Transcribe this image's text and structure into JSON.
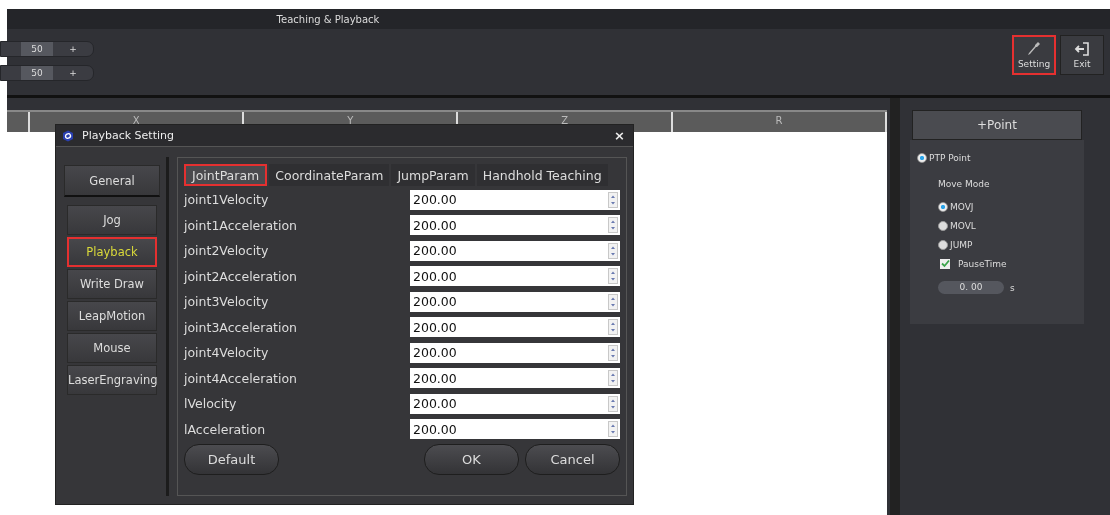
{
  "window": {
    "title": "Teaching & Playback"
  },
  "steppers": [
    {
      "value": "50",
      "plus": "+"
    },
    {
      "value": "50",
      "plus": "+"
    }
  ],
  "toolbar": [
    {
      "kind": "setting",
      "label": "Setting",
      "highlighted": true
    },
    {
      "kind": "exit",
      "label": "Exit",
      "highlighted": false
    }
  ],
  "table": {
    "columns": [
      "X",
      "Y",
      "Z",
      "R"
    ]
  },
  "right_panel": {
    "add_button": "+Point",
    "ptp": {
      "label": "PTP Point",
      "selected": true
    },
    "move_mode_label": "Move Mode",
    "modes": [
      {
        "label": "MOVJ",
        "selected": true
      },
      {
        "label": "MOVL",
        "selected": false
      },
      {
        "label": "JUMP",
        "selected": false
      }
    ],
    "pause": {
      "label": "PauseTime",
      "checked": true
    },
    "pause_value": "0. 00",
    "unit": "s"
  },
  "dialog": {
    "title": "Playback Setting",
    "close": "×",
    "nav": [
      {
        "label": "General",
        "selected": false,
        "highlighted": false
      },
      {
        "label": "Jog",
        "selected": false,
        "highlighted": false
      },
      {
        "label": "Playback",
        "selected": true,
        "highlighted": true
      },
      {
        "label": "Write  Draw",
        "selected": false,
        "highlighted": false
      },
      {
        "label": "LeapMotion",
        "selected": false,
        "highlighted": false
      },
      {
        "label": "Mouse",
        "selected": false,
        "highlighted": false
      },
      {
        "label": "LaserEngraving",
        "selected": false,
        "highlighted": false
      }
    ],
    "tabs": [
      {
        "label": "JointParam",
        "selected": true,
        "highlighted": true
      },
      {
        "label": "CoordinateParam",
        "selected": false,
        "highlighted": false
      },
      {
        "label": "JumpParam",
        "selected": false,
        "highlighted": false
      },
      {
        "label": "Handhold Teaching",
        "selected": false,
        "highlighted": false
      }
    ],
    "params": [
      {
        "label": "joint1Velocity",
        "value": "200.00"
      },
      {
        "label": "joint1Acceleration",
        "value": "200.00"
      },
      {
        "label": "joint2Velocity",
        "value": "200.00"
      },
      {
        "label": "joint2Acceleration",
        "value": "200.00"
      },
      {
        "label": "joint3Velocity",
        "value": "200.00"
      },
      {
        "label": "joint3Acceleration",
        "value": "200.00"
      },
      {
        "label": "joint4Velocity",
        "value": "200.00"
      },
      {
        "label": "joint4Acceleration",
        "value": "200.00"
      },
      {
        "label": "lVelocity",
        "value": "200.00"
      },
      {
        "label": "lAcceleration",
        "value": "200.00"
      }
    ],
    "buttons": {
      "default": "Default",
      "ok": "OK",
      "cancel": "Cancel"
    }
  }
}
